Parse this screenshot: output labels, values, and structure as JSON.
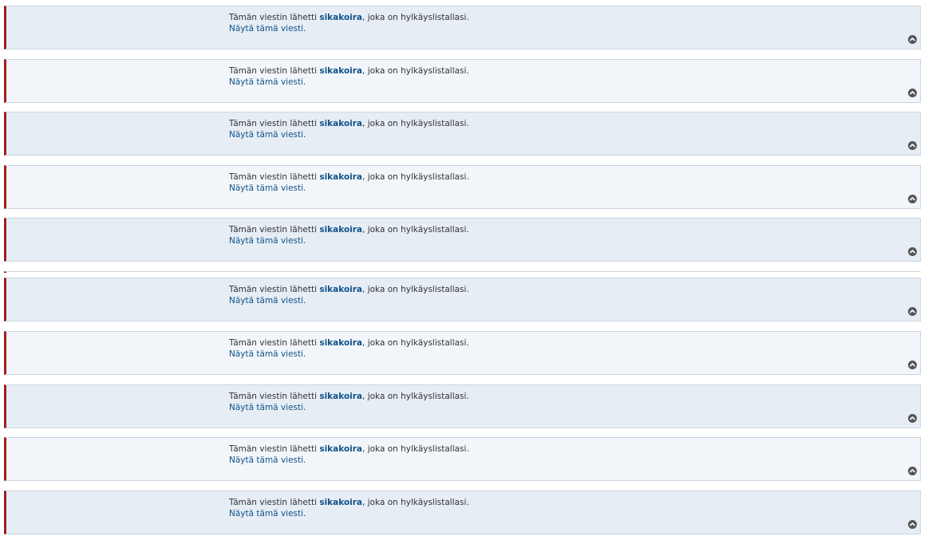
{
  "posts": [
    {
      "prefix": "Tämän viestin lähetti ",
      "author": "sikakoira",
      "suffix": ", joka on hylkäyslistallasi.",
      "show_label": "Näytä tämä viesti",
      "show_suffix": "."
    },
    {
      "prefix": "Tämän viestin lähetti ",
      "author": "sikakoira",
      "suffix": ", joka on hylkäyslistallasi.",
      "show_label": "Näytä tämä viesti",
      "show_suffix": "."
    },
    {
      "prefix": "Tämän viestin lähetti ",
      "author": "sikakoira",
      "suffix": ", joka on hylkäyslistallasi.",
      "show_label": "Näytä tämä viesti",
      "show_suffix": "."
    },
    {
      "prefix": "Tämän viestin lähetti ",
      "author": "sikakoira",
      "suffix": ", joka on hylkäyslistallasi.",
      "show_label": "Näytä tämä viesti",
      "show_suffix": "."
    },
    {
      "prefix": "Tämän viestin lähetti ",
      "author": "sikakoira",
      "suffix": ", joka on hylkäyslistallasi.",
      "show_label": "Näytä tämä viesti",
      "show_suffix": "."
    },
    {
      "prefix": "Tämän viestin lähetti ",
      "author": "sikakoira",
      "suffix": ", joka on hylkäyslistallasi.",
      "show_label": "Näytä tämä viesti",
      "show_suffix": "."
    },
    {
      "prefix": "Tämän viestin lähetti ",
      "author": "sikakoira",
      "suffix": ", joka on hylkäyslistallasi.",
      "show_label": "Näytä tämä viesti",
      "show_suffix": "."
    },
    {
      "prefix": "Tämän viestin lähetti ",
      "author": "sikakoira",
      "suffix": ", joka on hylkäyslistallasi.",
      "show_label": "Näytä tämä viesti",
      "show_suffix": "."
    },
    {
      "prefix": "Tämän viestin lähetti ",
      "author": "sikakoira",
      "suffix": ", joka on hylkäyslistallasi.",
      "show_label": "Näytä tämä viesti",
      "show_suffix": "."
    },
    {
      "prefix": "Tämän viestin lähetti ",
      "author": "sikakoira",
      "suffix": ", joka on hylkäyslistallasi.",
      "show_label": "Näytä tämä viesti",
      "show_suffix": "."
    }
  ],
  "icons": {
    "back_to_top": "chevron-up-circle-icon"
  },
  "colors": {
    "accent_border": "#a01e1e",
    "link": "#105289",
    "row_dark": "#e6edf5",
    "row_light": "#f2f6fa"
  }
}
